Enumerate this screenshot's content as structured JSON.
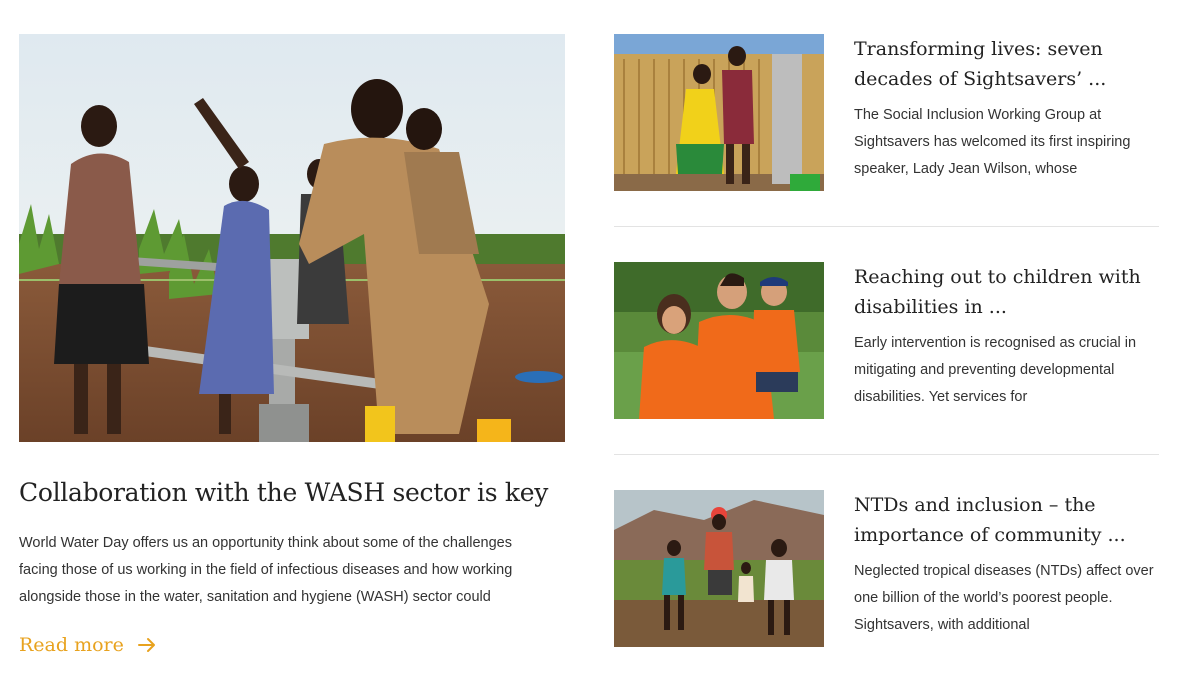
{
  "featured": {
    "image_alt": "People at a water pump in a field",
    "title": "Collaboration with the WASH sector is key",
    "excerpt": "World Water Day offers us an opportunity think about some of the challenges facing those of us working in the field of infectious diseases and how working alongside those in the water, sanitation and hygiene (WASH) sector could",
    "read_more": "Read more"
  },
  "cards": [
    {
      "image_alt": "Children at a hand water pump",
      "title": "Transforming lives: seven decades of Sightsavers’ ...",
      "excerpt": "The Social Inclusion Working Group at Sightsavers has welcomed its first inspiring speaker, Lady Jean Wilson, whose"
    },
    {
      "image_alt": "Two adults and a child in orange shirts",
      "title": "Reaching out to children with disabilities in ...",
      "excerpt": "Early intervention is recognised as crucial in mitigating and preventing developmental disabilities. Yet services for"
    },
    {
      "image_alt": "Children running across a field",
      "title": "NTDs and inclusion – the importance of community ...",
      "excerpt": "Neglected tropical diseases (NTDs) affect over one billion of the world’s poorest people. Sightsavers, with additional"
    }
  ],
  "colors": {
    "accent": "#e8a21e",
    "divider": "#e3e3e3",
    "heading": "#222222",
    "body": "#333333"
  }
}
